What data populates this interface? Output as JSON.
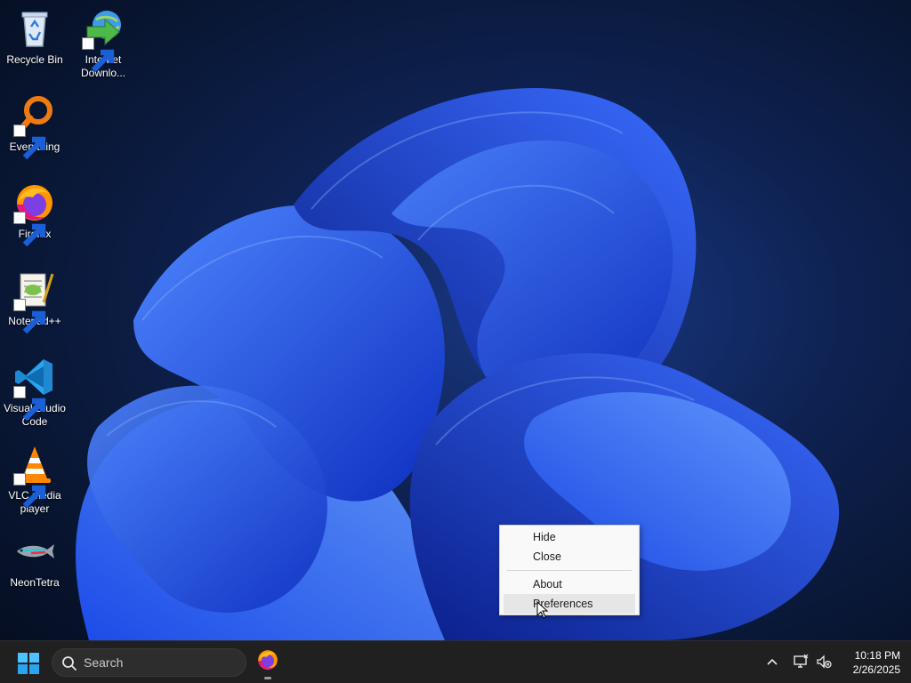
{
  "desktop": {
    "icons": [
      {
        "label": "Recycle Bin",
        "icon": "recycle-bin-icon"
      },
      {
        "label": "Internet Downlo...",
        "icon": "internet-download-manager-icon"
      },
      {
        "label": "Everything",
        "icon": "everything-search-icon"
      },
      {
        "label": "Firefox",
        "icon": "firefox-icon"
      },
      {
        "label": "Notepad++",
        "icon": "notepad-plus-plus-icon"
      },
      {
        "label": "Visual Studio Code",
        "icon": "vscode-icon"
      },
      {
        "label": "VLC media player",
        "icon": "vlc-icon"
      },
      {
        "label": "NeonTetra",
        "icon": "neontetra-fish-icon"
      }
    ]
  },
  "context_menu": {
    "items": [
      {
        "label": "Hide"
      },
      {
        "label": "Close"
      },
      {
        "label": "About"
      },
      {
        "label": "Preferences",
        "hovered": true
      }
    ]
  },
  "taskbar": {
    "search_label": "Search",
    "pinned": [
      {
        "icon": "firefox-icon",
        "running": true
      }
    ],
    "tray": {
      "time": "10:18 PM",
      "date": "2/26/2025"
    }
  },
  "colors": {
    "taskbar_bg": "#202020",
    "menu_bg": "#f9f9f9",
    "menu_hover": "#e6e6e6",
    "start_blue": "#4cc2ff"
  }
}
